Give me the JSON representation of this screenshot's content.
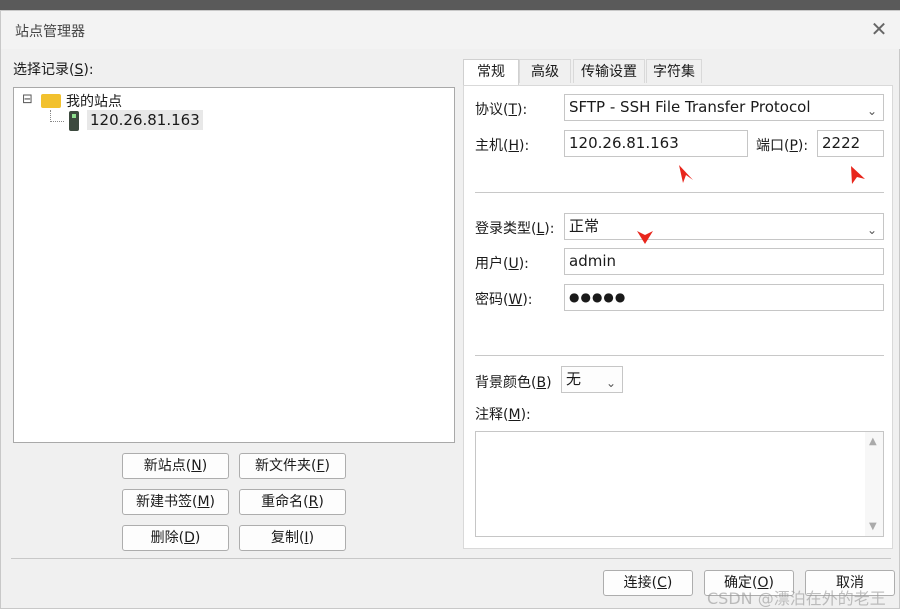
{
  "window": {
    "title": "站点管理器",
    "close_glyph": "✕"
  },
  "left": {
    "select_label": "选择记录(",
    "select_key": "S",
    "select_suffix": "):",
    "tree": {
      "root_toggle": "⊟",
      "root_label": "我的站点",
      "child_label": "120.26.81.163"
    },
    "buttons": {
      "new_site": [
        "新站点(",
        "N",
        ")"
      ],
      "new_folder": [
        "新文件夹(",
        "F",
        ")"
      ],
      "new_bookmark": [
        "新建书签(",
        "M",
        ")"
      ],
      "rename": [
        "重命名(",
        "R",
        ")"
      ],
      "delete": [
        "删除(",
        "D",
        ")"
      ],
      "copy": [
        "复制(",
        "I",
        ")"
      ]
    }
  },
  "tabs": [
    "常规",
    "高级",
    "传输设置",
    "字符集"
  ],
  "general": {
    "protocol_label": [
      "协议(",
      "T",
      "):"
    ],
    "protocol_value": "SFTP - SSH File Transfer Protocol",
    "host_label": [
      "主机(",
      "H",
      "):"
    ],
    "host_value": "120.26.81.163",
    "port_label": [
      "端口(",
      "P",
      "):"
    ],
    "port_value": "2222",
    "logon_label": [
      "登录类型(",
      "L",
      "):"
    ],
    "logon_value": "正常",
    "user_label": [
      "用户(",
      "U",
      "):"
    ],
    "user_value": "admin",
    "password_label": [
      "密码(",
      "W",
      "):"
    ],
    "password_value": "●●●●●",
    "bgcolor_label": [
      "背景颜色(",
      "B",
      ")"
    ],
    "bgcolor_value": "无",
    "comment_label": [
      "注释(",
      "M",
      "):"
    ]
  },
  "footer": {
    "connect": [
      "连接(",
      "C",
      ")"
    ],
    "ok": [
      "确定(",
      "O",
      ")"
    ],
    "cancel": "取消"
  },
  "watermark": "CSDN @漂泊在外的老王",
  "colors": {
    "annotation_arrow": "#e8261c",
    "folder": "#f2c12e"
  }
}
